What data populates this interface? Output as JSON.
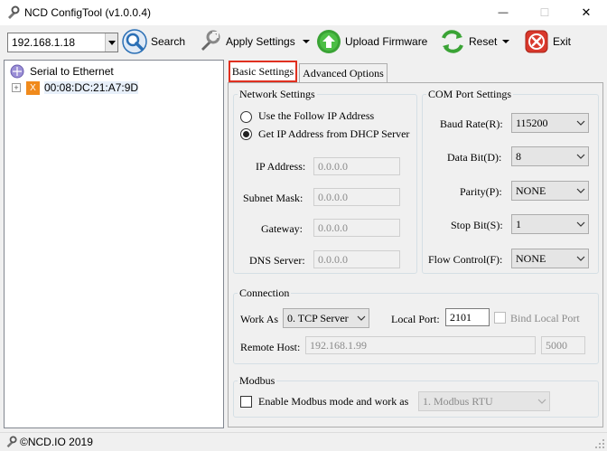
{
  "window": {
    "title": "NCD ConfigTool (v1.0.0.4)",
    "minimize_glyph": "—",
    "maximize_glyph": "☐",
    "close_glyph": "✕"
  },
  "toolbar": {
    "ip_value": "192.168.1.18",
    "search_label": "Search",
    "apply_label": "Apply Settings",
    "upload_label": "Upload Firmware",
    "reset_label": "Reset",
    "exit_label": "Exit"
  },
  "tree": {
    "root_label": "Serial to Ethernet",
    "device_label": "00:08:DC:21:A7:9D",
    "device_badge": "X",
    "expander": "+"
  },
  "tabs": {
    "basic": "Basic Settings",
    "advanced": "Advanced Options"
  },
  "network": {
    "legend": "Network Settings",
    "opt_static": "Use the Follow IP Address",
    "opt_dhcp": "Get IP Address from DHCP Server",
    "selected": "dhcp",
    "ip_label": "IP Address:",
    "ip_value": "0.0.0.0",
    "mask_label": "Subnet Mask:",
    "mask_value": "0.0.0.0",
    "gw_label": "Gateway:",
    "gw_value": "0.0.0.0",
    "dns_label": "DNS Server:",
    "dns_value": "0.0.0.0"
  },
  "com": {
    "legend": "COM Port Settings",
    "baud_label": "Baud Rate(R):",
    "baud_value": "115200",
    "data_label": "Data Bit(D):",
    "data_value": "8",
    "parity_label": "Parity(P):",
    "parity_value": "NONE",
    "stop_label": "Stop Bit(S):",
    "stop_value": "1",
    "flow_label": "Flow Control(F):",
    "flow_value": "NONE"
  },
  "connection": {
    "legend": "Connection",
    "work_as_label": "Work As",
    "work_as_value": "0. TCP Server",
    "local_port_label": "Local Port:",
    "local_port_value": "2101",
    "bind_label": "Bind Local Port",
    "remote_host_label": "Remote Host:",
    "remote_host_value": "192.168.1.99",
    "remote_port_value": "5000"
  },
  "modbus": {
    "legend": "Modbus",
    "enable_label": "Enable Modbus mode and work as",
    "mode_value": "1. Modbus RTU"
  },
  "status": {
    "copyright": "©NCD.IO 2019"
  },
  "colors": {
    "tab_highlight": "#e03020",
    "search_icon": "#2a6fb5",
    "upload_icon": "#3aa335",
    "exit_icon": "#d9382c",
    "device_badge": "#f08a1c"
  }
}
